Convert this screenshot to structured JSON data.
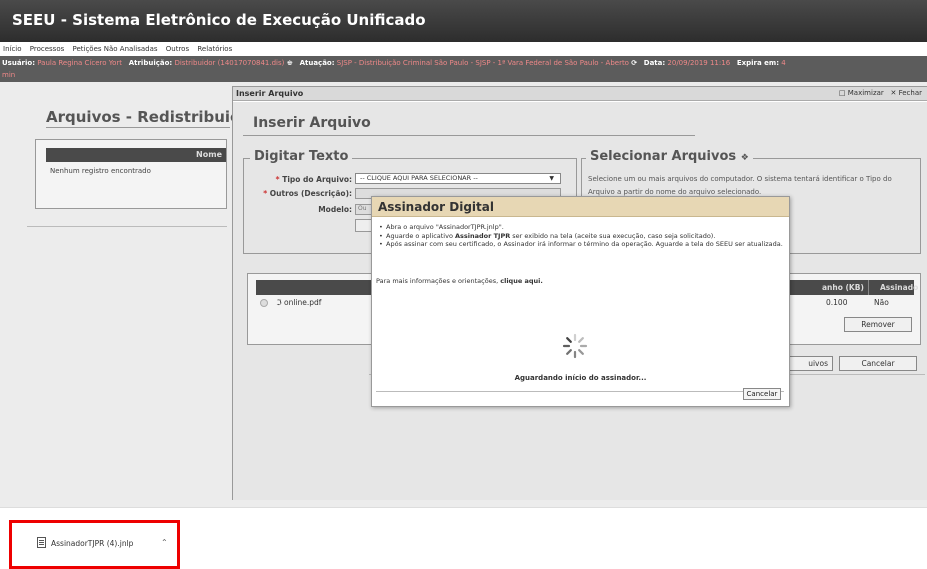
{
  "app": {
    "title": "SEEU - Sistema Eletrônico de Execução Unificado"
  },
  "menu": [
    "Início",
    "Processos",
    "Petições Não Analisadas",
    "Outros",
    "Relatórios"
  ],
  "info": {
    "usuario_label": "Usuário:",
    "usuario_value": "Paula Regina Cícero Yort",
    "atribuicao_label": "Atribuição:",
    "atribuicao_value": "Distribuidor (14017070841.dis)",
    "atuacao_label": "Atuação:",
    "atuacao_value": "SJSP - Distribuição Criminal São Paulo - SJSP - 1ª Vara Federal de São Paulo - Aberto",
    "data_label": "Data:",
    "data_value": "20/09/2019 11:16",
    "expira_label": "Expira em:",
    "expira_value": "4",
    "expira_unit": "min"
  },
  "left_panel": {
    "title": "Arquivos - Redistribuição",
    "table_header": "Nome",
    "empty_message": "Nenhum registro encontrado"
  },
  "insert_dialog": {
    "titlebar": "Inserir Arquivo",
    "maximize": "Maximizar",
    "close": "Fechar",
    "heading": "Inserir Arquivo",
    "digitar_legend": "Digitar Texto",
    "tipo_label": "Tipo do Arquivo:",
    "tipo_select": "-- CLIQUE AQUI PARA SELECIONAR --",
    "outros_label": "Outros (Descrição):",
    "modelo_label": "Modelo:",
    "modelo_partial": "Ou",
    "selecionar_legend": "Selecionar Arquivos",
    "selecionar_desc": "Selecione um ou mais arquivos do computador. O sistema tentará identificar o Tipo do Arquivo a partir do nome do arquivo selecionado.",
    "col_name_partial": "No",
    "col_size_partial": "anho (KB)",
    "col_signed": "Assinado",
    "file_name": "online.pdf",
    "file_size": "0.100",
    "file_signed": "Não",
    "remove_button": "Remover",
    "arquivos_partial": "uivos",
    "cancel_button": "Cancelar"
  },
  "modal": {
    "title": "Assinador Digital",
    "items": [
      "Abra o arquivo \"AssinadorTJPR.jnlp\".",
      "Aguarde o aplicativo Assinador TJPR ser exibido na tela (aceite sua execução, caso seja solicitado).",
      "Após assinar com seu certificado, o Assinador irá informar o término da operação. Aguarde a tela do SEEU ser atualizada."
    ],
    "more_prefix": "Para mais informações e orientações,",
    "more_link": "clique aqui.",
    "status": "Aguardando início do assinador...",
    "cancel": "Cancelar"
  },
  "download": {
    "file": "AssinadorTJPR (4).jnlp"
  },
  "colors": {
    "highlight": "#e00000",
    "modal_title_bg": "#e7d7b4",
    "header_bg": "#3a3a3a"
  }
}
